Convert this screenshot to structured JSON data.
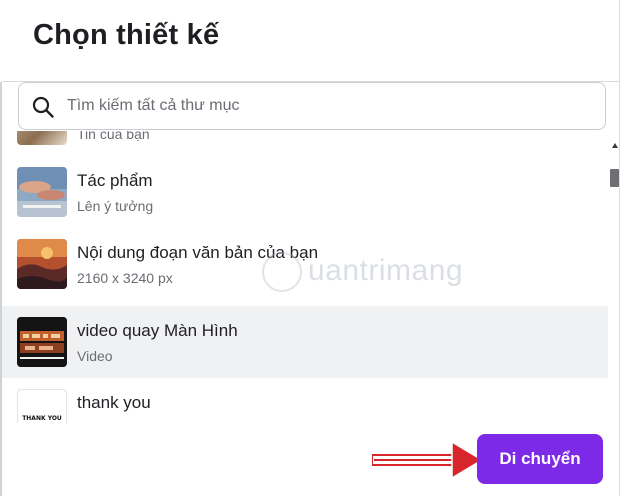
{
  "dialog": {
    "title": "Chọn thiết kế"
  },
  "search": {
    "placeholder": "Tìm kiếm tất cả thư mục",
    "value": ""
  },
  "items": [
    {
      "name": "",
      "subtitle": "Tin của bạn",
      "thumb": "photo-group",
      "selected": false
    },
    {
      "name": "Tác phẩm",
      "subtitle": "Lên ý tưởng",
      "thumb": "sky-artwork",
      "selected": false
    },
    {
      "name": "Nội dung đoạn văn bản của bạn",
      "subtitle": "2160 x 3240 px",
      "thumb": "sunset-painting",
      "selected": false
    },
    {
      "name": "video quay Màn Hình",
      "subtitle": "Video",
      "thumb": "video-frame",
      "selected": true
    },
    {
      "name": "thank you",
      "subtitle": "",
      "thumb_text": "THANK YOU",
      "thumb": "thank-you-card",
      "selected": false
    }
  ],
  "watermark": {
    "text": "uantrimang"
  },
  "actions": {
    "move_label": "Di chuyển"
  },
  "colors": {
    "accent": "#7d2ae8",
    "arrow": "#d7262c",
    "selected_row": "#f0f1f3"
  }
}
